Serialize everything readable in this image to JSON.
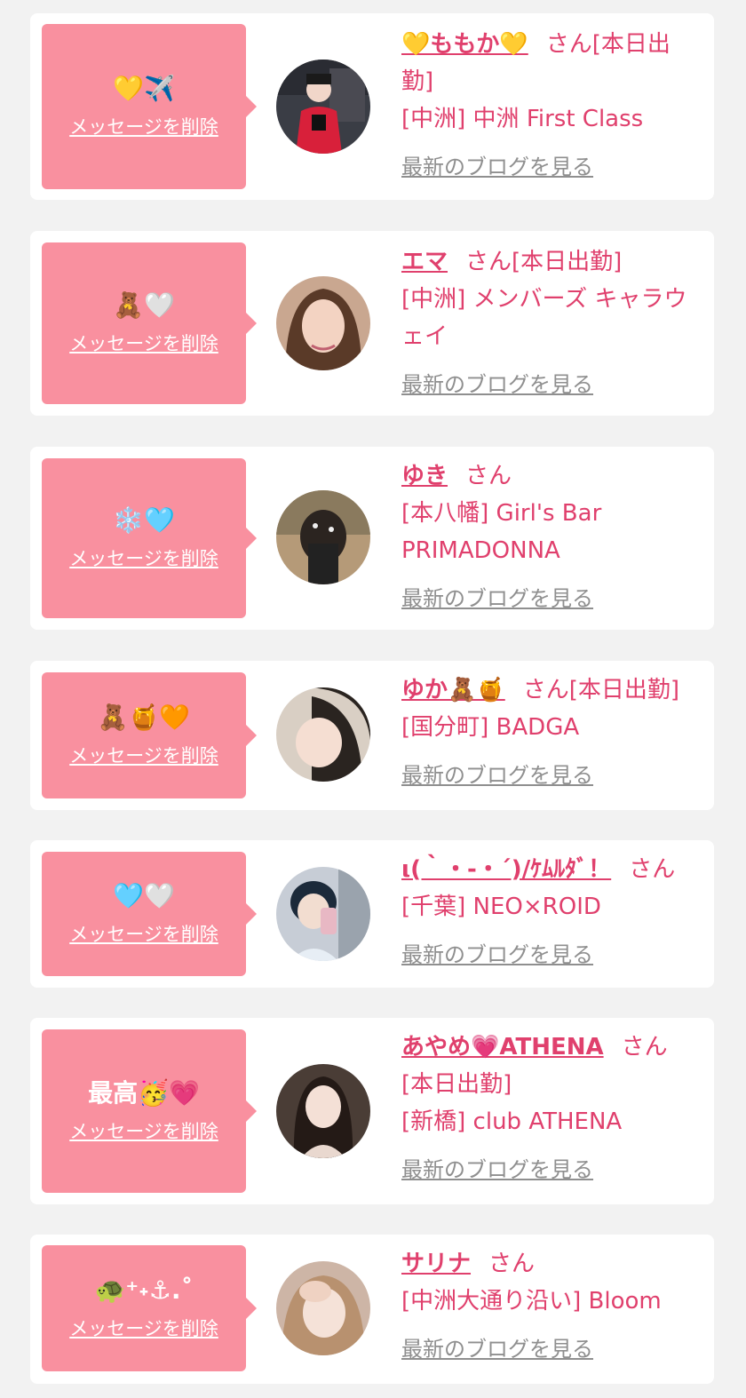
{
  "delete_label": "メッセージを削除",
  "blog_label": "最新のブログを見る",
  "honorific": "さん",
  "colors": {
    "page_bg": "#f2f2f2",
    "card_bg": "#ffffff",
    "bubble_bg": "#f9909f",
    "accent_text": "#e0406d",
    "link_gray": "#8f8f8f"
  },
  "items": [
    {
      "message": "💛✈️",
      "name": "💛ももか💛",
      "status": "[本日出勤]",
      "shop": "[中洲] 中洲 First Class",
      "avatar": "photo-woman-red-dress-icon"
    },
    {
      "message": "🧸🤍",
      "name": "エマ",
      "status": "[本日出勤]",
      "shop": "[中洲] メンバーズ キャラウェイ",
      "avatar": "photo-woman-selfie-icon"
    },
    {
      "message": "❄️🩵",
      "name": "ゆき",
      "status": "",
      "shop": "[本八幡] Girl's Bar PRIMADONNA",
      "avatar": "photo-braided-hair-icon"
    },
    {
      "message": "🧸🍯🧡",
      "name": "ゆか🧸🍯",
      "status": "[本日出勤]",
      "shop": "[国分町] BADGA",
      "avatar": "photo-woman-face-icon"
    },
    {
      "message": "🩵🤍",
      "name": "ι(｀・-・´)/ｹﾑﾙﾀﾞ！",
      "status": "",
      "shop": "[千葉] NEO×ROID",
      "avatar": "photo-mirror-selfie-icon"
    },
    {
      "message": "最高🥳💗",
      "name": "あやめ💗ATHENA",
      "status": "[本日出勤]",
      "shop": "[新橋] club ATHENA",
      "avatar": "photo-woman-dark-hair-icon"
    },
    {
      "message": "🐢⁺˖⚓︎.˚",
      "name": "サリナ",
      "status": "",
      "shop": "[中洲大通り沿い] Bloom",
      "avatar": "photo-woman-hand-face-icon"
    }
  ]
}
